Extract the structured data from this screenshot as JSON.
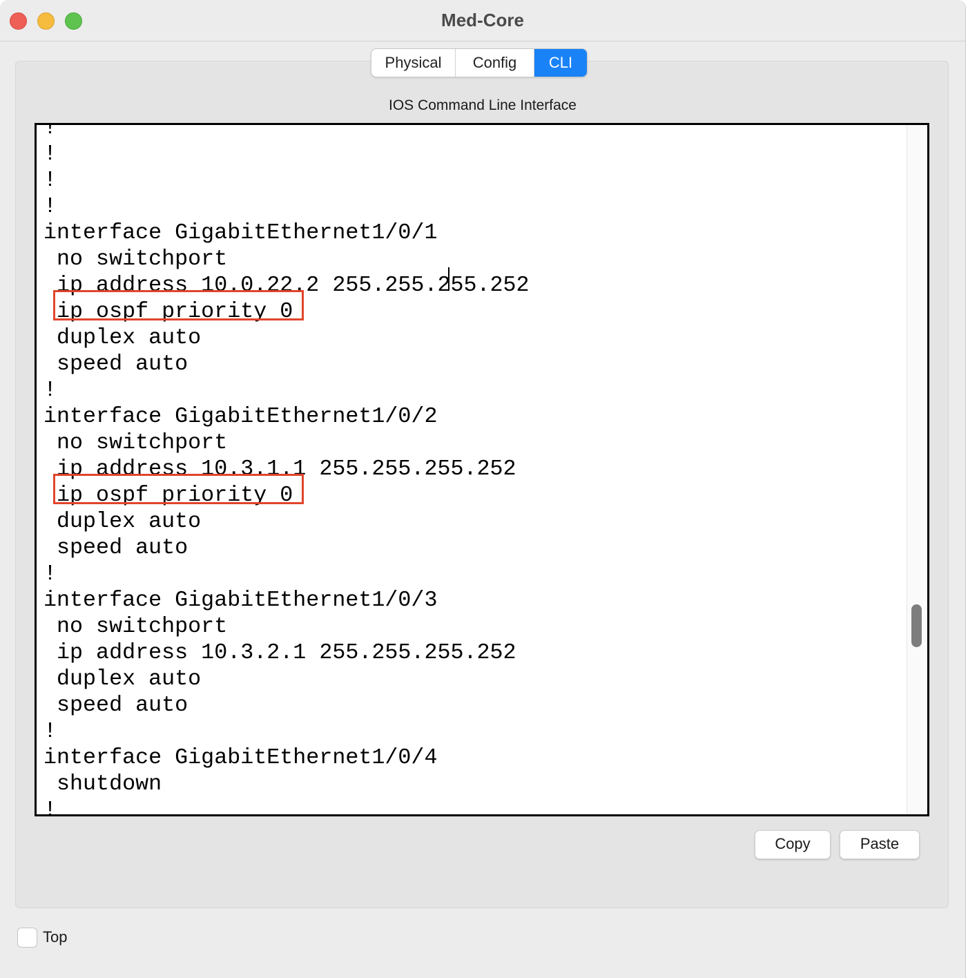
{
  "window": {
    "title": "Med-Core"
  },
  "tabs": [
    {
      "label": "Physical",
      "active": false
    },
    {
      "label": "Config",
      "active": false
    },
    {
      "label": "CLI",
      "active": true
    }
  ],
  "cli": {
    "heading": "IOS Command Line Interface",
    "lines": [
      "!",
      "!",
      "!",
      "!",
      "interface GigabitEthernet1/0/1",
      " no switchport",
      " ip address 10.0.22.2 255.255.255.252",
      " ip ospf priority 0",
      " duplex auto",
      " speed auto",
      "!",
      "interface GigabitEthernet1/0/2",
      " no switchport",
      " ip address 10.3.1.1 255.255.255.252",
      " ip ospf priority 0",
      " duplex auto",
      " speed auto",
      "!",
      "interface GigabitEthernet1/0/3",
      " no switchport",
      " ip address 10.3.2.1 255.255.255.252",
      " duplex auto",
      " speed auto",
      "!",
      "interface GigabitEthernet1/0/4",
      " shutdown",
      "!"
    ]
  },
  "buttons": {
    "copy": "Copy",
    "paste": "Paste"
  },
  "options": {
    "top_label": "Top",
    "top_checked": false
  },
  "colors": {
    "active_tab": "#1a82f7",
    "highlight_box": "#e0452b",
    "close": "#ee5f57",
    "minimize": "#f5bc3f",
    "maximize": "#5ec34f"
  }
}
